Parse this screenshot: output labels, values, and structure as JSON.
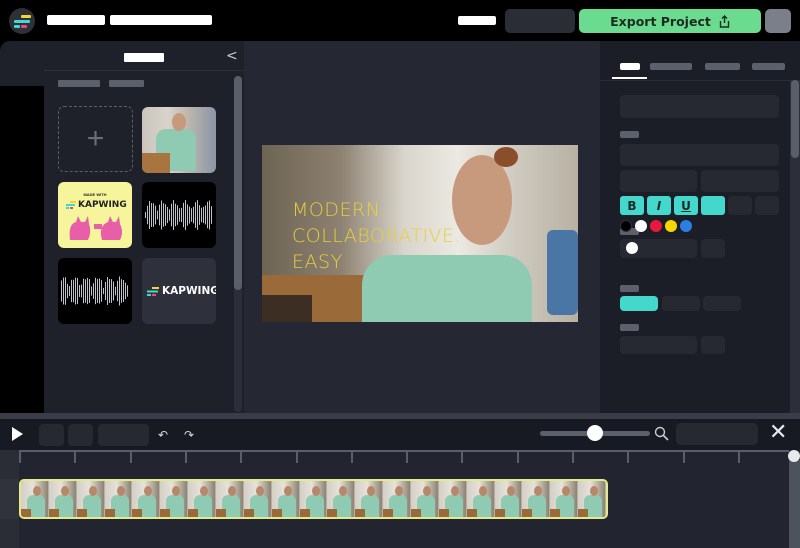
{
  "topbar": {
    "logo_icon": "kapwing-logo-icon",
    "export_label": "Export Project",
    "export_icon": "share-upload-icon",
    "colors": {
      "export_bg": "#6bdc8f",
      "logo_yellow": "#f3d43c",
      "logo_teal": "#44d7cc",
      "logo_pink": "#e8458b"
    }
  },
  "left_panel": {
    "collapse_icon": "chevron-left-icon",
    "add_media_icon": "plus-icon",
    "tiles": [
      {
        "kind": "add-media"
      },
      {
        "kind": "video-thumbnail"
      },
      {
        "kind": "image",
        "caption_small": "MADE WITH",
        "caption": "KAPWING"
      },
      {
        "kind": "audio-waveform"
      },
      {
        "kind": "audio-waveform"
      },
      {
        "kind": "logo",
        "caption": "KAPWING"
      }
    ]
  },
  "canvas": {
    "video_text_lines": [
      "MODERN.",
      "COLLABORATIVE.",
      "EASY"
    ],
    "text_color": "#e8cf3c"
  },
  "right_panel": {
    "format_buttons": [
      {
        "label": "B",
        "name": "bold"
      },
      {
        "label": "I",
        "name": "italic"
      },
      {
        "label": "U",
        "name": "underline"
      }
    ],
    "accent": "#44d7cc",
    "selected_color": "#ffffff",
    "swatches": [
      "#000000",
      "#ffffff",
      "#e8193c",
      "#f5d800",
      "#2a7fe0"
    ]
  },
  "timeline": {
    "play_icon": "play-icon",
    "undo_icon": "↶",
    "redo_icon": "↷",
    "zoom_level": 0.5,
    "search_icon": "🔍",
    "close_icon": "✕",
    "clip_frames": 21,
    "clip_border": "#e3ea8c"
  }
}
